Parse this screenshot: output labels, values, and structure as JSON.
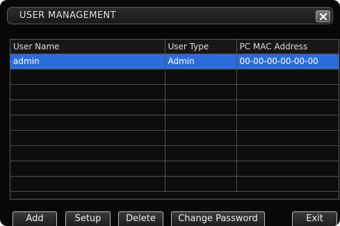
{
  "window": {
    "title": "USER MANAGEMENT"
  },
  "table": {
    "columns": [
      "User Name",
      "User Type",
      "PC MAC Address"
    ],
    "rows": [
      [
        "admin",
        "Admin",
        "00-00-00-00-00-00"
      ]
    ],
    "selected_row": 0,
    "empty_rows": 8
  },
  "buttons": {
    "add": "Add",
    "setup": "Setup",
    "delete": "Delete",
    "change_password": "Change Password",
    "exit": "Exit"
  },
  "colors": {
    "selection": "#2b6cdc",
    "background": "#080808"
  },
  "icons": {
    "close": "close-icon"
  }
}
